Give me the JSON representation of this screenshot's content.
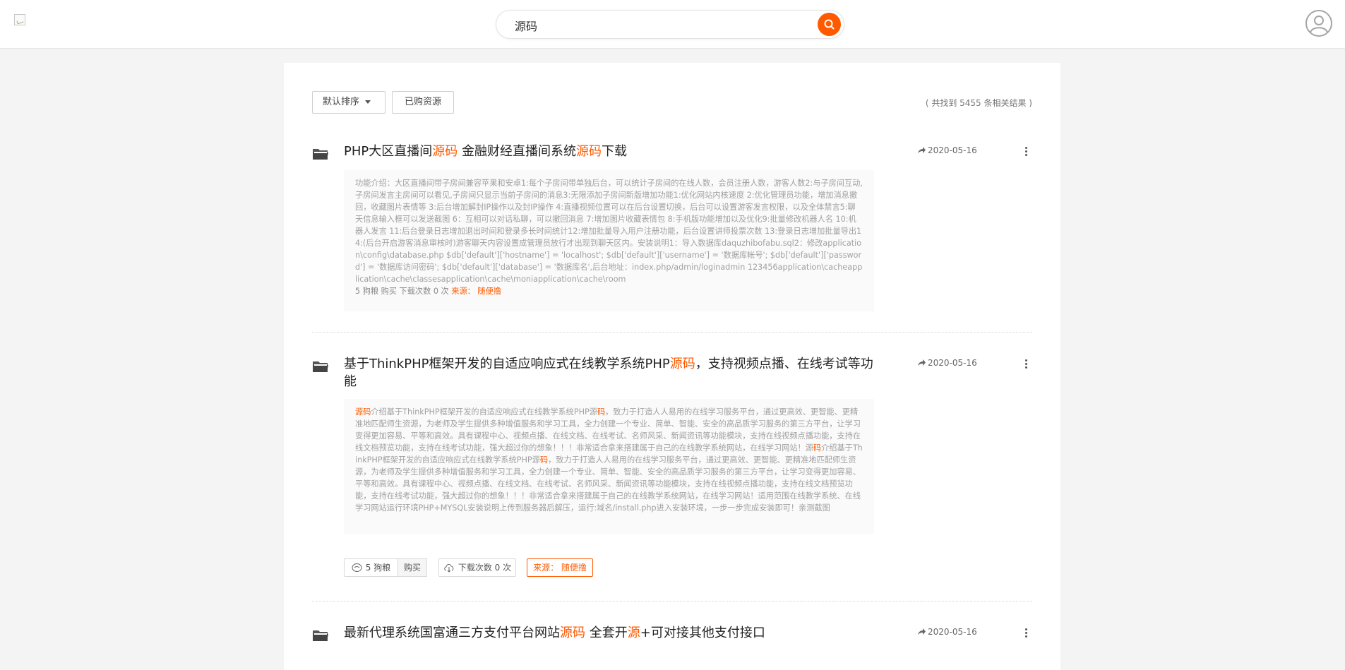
{
  "header": {
    "search_value": "源码"
  },
  "toolbar": {
    "sort_label": "默认排序",
    "bought_label": "已购资源",
    "result_count": "( 共找到 5455 条相关结果 )"
  },
  "items": [
    {
      "title_parts": [
        "PHP大区直播间",
        "源码",
        " 金融财经直播间系统",
        "源码",
        "下载"
      ],
      "date": "2020-05-16",
      "desc": "功能介绍：大区直播间带子房间兼容苹果和安卓1:每个子房间带单独后台，可以统计子房间的在线人数，会员注册人数，游客人数2:与子房间互动,子房间发言主房间可以看见,子房间只显示当前子房间的消息3:无限添加子房间新版增加功能1:优化网站内核速度 2:优化管理员功能，增加消息撤回，收藏图片表情等 3:后台增加解封IP操作以及封IP操作 4:直播视频位置可以在后台设置切换，后台可以设置游客发言权限，以及全体禁言5:聊天信息输入框可以发送截图 6：互相可以对话私聊，可以撤回消息 7:增加图片收藏表情包 8:手机版功能增加以及优化9:批量修改机器人名 10:机器人发言 11:后台登录日志增加退出时间和登录多长时间统计12:增加批量导入用户注册功能，后台设置讲师投票次数 13:登录日志增加批量导出14:(后台开启游客消息审核时)游客聊天内容设置成管理员放行才出现到聊天区内。安装说明1：导入数据库daquzhibofabu.sql2：修改application\\config\\database.php $db['default']['hostname'] = 'localhost'; $db['default']['username'] = '数据库帐号'; $db['default']['password'] = '数据库访问密码'; $db['default']['database'] = '数据库名',后台地址：index.php/admin/loginadmin 123456application\\cacheapplication\\cache\\classesapplication\\cache\\moniapplication\\cache\\room",
      "meta": "5 狗粮 购买 下载次数 0 次",
      "source": "来源： 随便撸"
    },
    {
      "title_parts": [
        "基于ThinkPHP框架开发的自适应响应式在线教学系统PHP",
        "源码",
        "，支持视频点播、在线考试等功能"
      ],
      "date": "2020-05-16",
      "desc_parts": [
        "源",
        "码",
        "介绍基于ThinkPHP框架开发的自适应响应式在线教学系统PHP源",
        "码",
        "，致力于打造人人易用的在线学习服务平台，通过更高效、更智能、更精准地匹配师生资源，为老师及学生提供多种增值服务和学习工具，全力创建一个专业、简单、智能、安全的高品质学习服务的第三方平台，让学习变得更加容易、平等和高效。具有课程中心、视频点播、在线文档、在线考试、名师风采、新闻资讯等功能模块，支持在线视频点播功能，支持在线文档预览功能，支持在线考试功能，强大超过你的想象！！！非常适合拿来搭建属于自己的在线教学系统网站，在线学习网站！源",
        "码",
        "介绍基于ThinkPHP框架开发的自适应响应式在线教学系统PHP源",
        "码",
        "，致力于打造人人易用的在线学习服务平台，通过更高效、更智能、更精准地匹配师生资源，为老师及学生提供多种增值服务和学习工具，全力创建一个专业、简单、智能、安全的高品质学习服务的第三方平台，让学习变得更加容易、平等和高效。具有课程中心、视频点播、在线文档、在线考试、名师风采、新闻资讯等功能模块，支持在线视频点播功能，支持在线文档预览功能，支持在线考试功能，强大超过你的想象！！！非常适合拿来搭建属于自己的在线教学系统网站，在线学习网站！适用范围在线教学系统、在线学习网站运行环境PHP+MYSQL安装说明上传到服务器后解压，运行:域名/install.php进入安装环境，一步一步完成安装即可！亲测截图"
      ],
      "price": "5 狗粮",
      "buy": "购买",
      "downloads": "下载次数 0 次",
      "source": "来源： 随便撸"
    },
    {
      "title_parts": [
        "最新代理系统国富通三方支付平台网站",
        "源码",
        " 全套开",
        "源",
        "+可对接其他支付接口"
      ],
      "date": "2020-05-16"
    }
  ],
  "icons": {
    "folder": "folder-icon",
    "share": "share-icon",
    "more": "more-vertical-icon",
    "search": "search-icon",
    "coin": "coin-icon",
    "cloud": "cloud-download-icon"
  },
  "colors": {
    "accent": "#ff5a00",
    "background": "#f4f4f4"
  }
}
